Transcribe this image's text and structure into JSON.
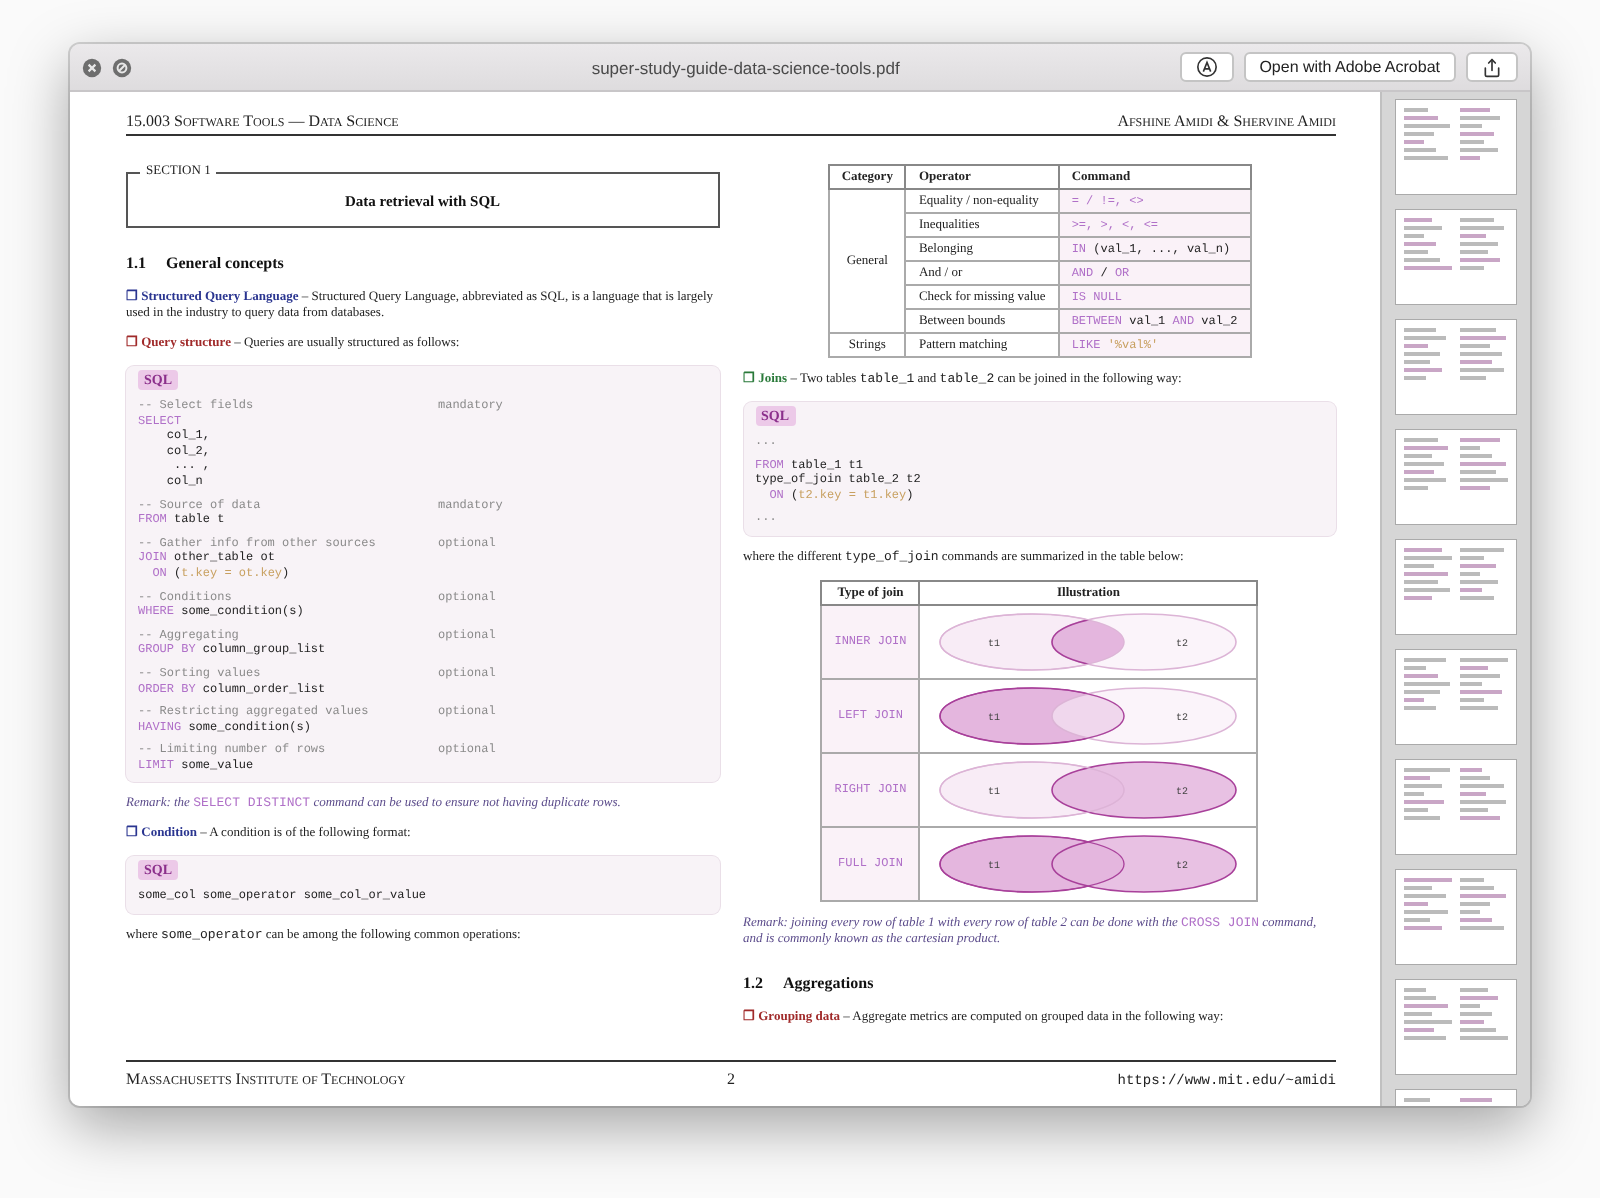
{
  "window": {
    "title": "super-study-guide-data-science-tools.pdf",
    "open_button": "Open with Adobe Acrobat"
  },
  "page": {
    "header": {
      "left": "15.003 Software Tools — Data Science",
      "right": "Afshine Amidi & Shervine Amidi"
    },
    "columns": [
      {
        "blocks": [
          {
            "kind": "section",
            "legend": "SECTION 1",
            "title": "Data retrieval with SQL"
          },
          {
            "kind": "heading",
            "number": "1.1",
            "title": "General concepts"
          },
          {
            "kind": "paragraph",
            "segments": [
              {
                "kind": "term",
                "text": "❐ Structured Query Language",
                "color": "#2a3590"
              },
              {
                "kind": "text",
                "text": " – Structured Query Language, abbreviated as SQL, is a language that is largely used in the industry to query data from databases."
              }
            ]
          },
          {
            "kind": "paragraph",
            "segments": [
              {
                "kind": "term",
                "text": "❐ Query structure",
                "color": "#a02a2a"
              },
              {
                "kind": "text",
                "text": " – Queries are usually structured as follows:"
              }
            ]
          },
          {
            "kind": "code",
            "label": "SQL",
            "groups": [
              {
                "lines": [
                  {
                    "segments": [
                      {
                        "kind": "comment",
                        "text": "-- Select fields"
                      }
                    ],
                    "note": "mandatory"
                  },
                  {
                    "segments": [
                      {
                        "kind": "kw",
                        "text": "SELECT"
                      }
                    ]
                  },
                  {
                    "segments": [
                      {
                        "kind": "code",
                        "text": "    col_1,"
                      }
                    ]
                  },
                  {
                    "segments": [
                      {
                        "kind": "code",
                        "text": "    col_2,"
                      }
                    ]
                  },
                  {
                    "segments": [
                      {
                        "kind": "code",
                        "text": "     ... ,"
                      }
                    ]
                  },
                  {
                    "segments": [
                      {
                        "kind": "code",
                        "text": "    col_n"
                      }
                    ]
                  }
                ]
              },
              {
                "lines": [
                  {
                    "segments": [
                      {
                        "kind": "comment",
                        "text": "-- Source of data"
                      }
                    ],
                    "note": "mandatory"
                  },
                  {
                    "segments": [
                      {
                        "kind": "kw",
                        "text": "FROM"
                      },
                      {
                        "kind": "code",
                        "text": " table t"
                      }
                    ]
                  }
                ]
              },
              {
                "lines": [
                  {
                    "segments": [
                      {
                        "kind": "comment",
                        "text": "-- Gather info from other sources"
                      }
                    ],
                    "note": "optional"
                  },
                  {
                    "segments": [
                      {
                        "kind": "kw",
                        "text": "JOIN"
                      },
                      {
                        "kind": "code",
                        "text": " other_table ot"
                      }
                    ]
                  },
                  {
                    "segments": [
                      {
                        "kind": "kw",
                        "text": "  ON"
                      },
                      {
                        "kind": "code",
                        "text": " ("
                      },
                      {
                        "kind": "str",
                        "text": "t.key = ot.key"
                      },
                      {
                        "kind": "code",
                        "text": ")"
                      }
                    ]
                  }
                ]
              },
              {
                "lines": [
                  {
                    "segments": [
                      {
                        "kind": "comment",
                        "text": "-- Conditions"
                      }
                    ],
                    "note": "optional"
                  },
                  {
                    "segments": [
                      {
                        "kind": "kw",
                        "text": "WHERE"
                      },
                      {
                        "kind": "code",
                        "text": " some_condition(s)"
                      }
                    ]
                  }
                ]
              },
              {
                "lines": [
                  {
                    "segments": [
                      {
                        "kind": "comment",
                        "text": "-- Aggregating"
                      }
                    ],
                    "note": "optional"
                  },
                  {
                    "segments": [
                      {
                        "kind": "kw",
                        "text": "GROUP BY"
                      },
                      {
                        "kind": "code",
                        "text": " column_group_list"
                      }
                    ]
                  }
                ]
              },
              {
                "lines": [
                  {
                    "segments": [
                      {
                        "kind": "comment",
                        "text": "-- Sorting values"
                      }
                    ],
                    "note": "optional"
                  },
                  {
                    "segments": [
                      {
                        "kind": "kw",
                        "text": "ORDER BY"
                      },
                      {
                        "kind": "code",
                        "text": " column_order_list"
                      }
                    ]
                  }
                ]
              },
              {
                "lines": [
                  {
                    "segments": [
                      {
                        "kind": "comment",
                        "text": "-- Restricting aggregated values"
                      }
                    ],
                    "note": "optional"
                  },
                  {
                    "segments": [
                      {
                        "kind": "kw",
                        "text": "HAVING"
                      },
                      {
                        "kind": "code",
                        "text": " some_condition(s)"
                      }
                    ]
                  }
                ]
              },
              {
                "lines": [
                  {
                    "segments": [
                      {
                        "kind": "comment",
                        "text": "-- Limiting number of rows"
                      }
                    ],
                    "note": "optional"
                  },
                  {
                    "segments": [
                      {
                        "kind": "kw",
                        "text": "LIMIT"
                      },
                      {
                        "kind": "code",
                        "text": " some_value"
                      }
                    ]
                  }
                ]
              }
            ]
          },
          {
            "kind": "paragraph",
            "segments": [
              {
                "kind": "italic",
                "text": "Remark: the "
              },
              {
                "kind": "kw",
                "text": "SELECT DISTINCT"
              },
              {
                "kind": "italic",
                "text": " command can be used to ensure not having duplicate rows."
              }
            ]
          },
          {
            "kind": "paragraph",
            "segments": [
              {
                "kind": "term",
                "text": "❐ Condition",
                "color": "#2a3590"
              },
              {
                "kind": "text",
                "text": " – A condition is of the following format:"
              }
            ]
          },
          {
            "kind": "code",
            "label": "SQL",
            "groups": [
              {
                "lines": [
                  {
                    "segments": [
                      {
                        "kind": "code",
                        "text": "some_col some_operator some_col_or_value"
                      }
                    ]
                  }
                ]
              }
            ]
          },
          {
            "kind": "paragraph",
            "segments": [
              {
                "kind": "text",
                "text": "where "
              },
              {
                "kind": "code",
                "text": "some_operator"
              },
              {
                "kind": "text",
                "text": " can be among the following common operations:"
              }
            ]
          }
        ]
      },
      {
        "blocks": [
          {
            "kind": "operator_table",
            "columns": [
              "Category",
              "Operator",
              "Command"
            ],
            "groups": [
              {
                "category": "General",
                "rows": [
                  {
                    "operator": "Equality / non-equality",
                    "command": [
                      {
                        "kind": "kw",
                        "text": "= / !=, <>"
                      }
                    ]
                  },
                  {
                    "operator": "Inequalities",
                    "command": [
                      {
                        "kind": "kw",
                        "text": ">=, >, <, <="
                      }
                    ]
                  },
                  {
                    "operator": "Belonging",
                    "command": [
                      {
                        "kind": "kw",
                        "text": "IN"
                      },
                      {
                        "kind": "code",
                        "text": " (val_1, ..., val_n)"
                      }
                    ]
                  },
                  {
                    "operator": "And / or",
                    "command": [
                      {
                        "kind": "kw",
                        "text": "AND"
                      },
                      {
                        "kind": "code",
                        "text": " / "
                      },
                      {
                        "kind": "kw",
                        "text": "OR"
                      }
                    ]
                  },
                  {
                    "operator": "Check for missing value",
                    "command": [
                      {
                        "kind": "kw",
                        "text": "IS NULL"
                      }
                    ]
                  },
                  {
                    "operator": "Between bounds",
                    "command": [
                      {
                        "kind": "kw",
                        "text": "BETWEEN"
                      },
                      {
                        "kind": "code",
                        "text": " val_1 "
                      },
                      {
                        "kind": "kw",
                        "text": "AND"
                      },
                      {
                        "kind": "code",
                        "text": " val_2"
                      }
                    ]
                  }
                ]
              },
              {
                "category": "Strings",
                "rows": [
                  {
                    "operator": "Pattern matching",
                    "command": [
                      {
                        "kind": "kw",
                        "text": "LIKE"
                      },
                      {
                        "kind": "str",
                        "text": " '%val%'"
                      }
                    ]
                  }
                ]
              }
            ]
          },
          {
            "kind": "paragraph",
            "segments": [
              {
                "kind": "term",
                "text": "❐ Joins",
                "color": "#2a7a3a"
              },
              {
                "kind": "text",
                "text": " – Two tables "
              },
              {
                "kind": "code",
                "text": "table_1"
              },
              {
                "kind": "text",
                "text": " and "
              },
              {
                "kind": "code",
                "text": "table_2"
              },
              {
                "kind": "text",
                "text": " can be joined in the following way:"
              }
            ]
          },
          {
            "kind": "code",
            "label": "SQL",
            "groups": [
              {
                "lines": [
                  {
                    "segments": [
                      {
                        "kind": "comment",
                        "text": "..."
                      }
                    ]
                  }
                ]
              },
              {
                "lines": [
                  {
                    "segments": [
                      {
                        "kind": "kw",
                        "text": "FROM"
                      },
                      {
                        "kind": "code",
                        "text": " table_1 t1"
                      }
                    ]
                  },
                  {
                    "segments": [
                      {
                        "kind": "code",
                        "text": "type_of_join table_2 t2"
                      }
                    ]
                  },
                  {
                    "segments": [
                      {
                        "kind": "kw",
                        "text": "  ON"
                      },
                      {
                        "kind": "code",
                        "text": " ("
                      },
                      {
                        "kind": "str",
                        "text": "t2.key = t1.key"
                      },
                      {
                        "kind": "code",
                        "text": ")"
                      }
                    ]
                  }
                ]
              },
              {
                "lines": [
                  {
                    "segments": [
                      {
                        "kind": "comment",
                        "text": "..."
                      }
                    ]
                  }
                ]
              }
            ]
          },
          {
            "kind": "paragraph",
            "segments": [
              {
                "kind": "text",
                "text": "where the different "
              },
              {
                "kind": "code",
                "text": "type_of_join"
              },
              {
                "kind": "text",
                "text": " commands are summarized in the table below:"
              }
            ]
          },
          {
            "kind": "join_table",
            "columns": [
              "Type of join",
              "Illustration"
            ],
            "rows": [
              {
                "type": "INNER JOIN",
                "kind": "inner",
                "labels": [
                  "t1",
                  "t2"
                ]
              },
              {
                "type": "LEFT JOIN",
                "kind": "left",
                "labels": [
                  "t1",
                  "t2"
                ]
              },
              {
                "type": "RIGHT JOIN",
                "kind": "right",
                "labels": [
                  "t1",
                  "t2"
                ]
              },
              {
                "type": "FULL JOIN",
                "kind": "full",
                "labels": [
                  "t1",
                  "t2"
                ]
              }
            ]
          },
          {
            "kind": "paragraph",
            "segments": [
              {
                "kind": "italic",
                "text": "Remark: joining every row of table 1 with every row of table 2 can be done with the "
              },
              {
                "kind": "kw",
                "text": "CROSS JOIN"
              },
              {
                "kind": "italic",
                "text": " command, and is commonly known as the cartesian product."
              }
            ]
          },
          {
            "kind": "heading",
            "number": "1.2",
            "title": "Aggregations"
          },
          {
            "kind": "paragraph",
            "segments": [
              {
                "kind": "term",
                "text": "❐ Grouping data",
                "color": "#a02a2a"
              },
              {
                "kind": "text",
                "text": " – Aggregate metrics are computed on grouped data in the following way:"
              }
            ]
          }
        ]
      }
    ],
    "footer": {
      "left": "Massachusetts Institute of Technology",
      "center": "2",
      "right": "https://www.mit.edu/~amidi"
    }
  }
}
